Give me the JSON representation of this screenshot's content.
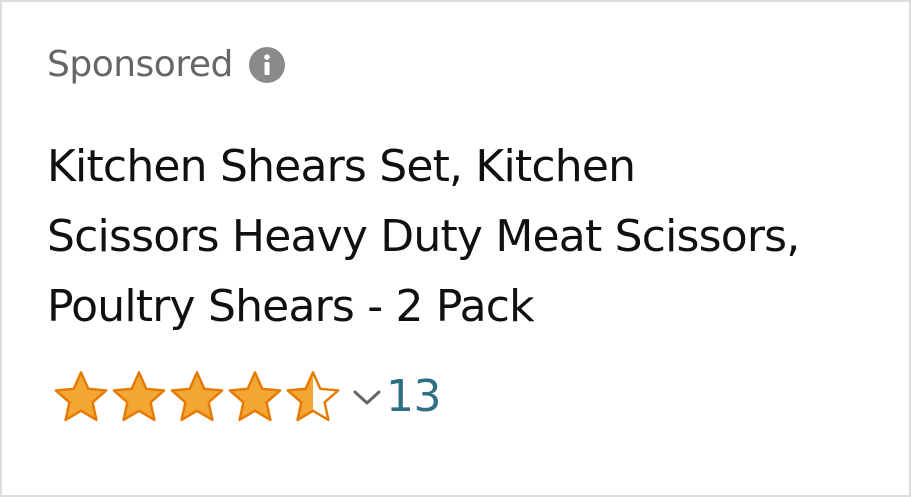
{
  "ad": {
    "sponsored_label": "Sponsored",
    "info_icon": "info-icon"
  },
  "product": {
    "title_lines": [
      "Kitchen Shears Set, Kitchen",
      "Scissors Heavy Duty Meat Scissors,",
      "Poultry Shears - 2 Pack"
    ]
  },
  "rating": {
    "stars": 4.5,
    "max_stars": 5,
    "review_count": "13",
    "dropdown_icon": "chevron-down-icon"
  },
  "colors": {
    "star_fill": "#F3A633",
    "star_stroke": "#E67A00",
    "sponsored_text": "#666666",
    "title_text": "#0F1111",
    "link_text": "#2F6F85",
    "info_icon_bg": "#8A8A8A",
    "border": "#DDDDDD"
  }
}
